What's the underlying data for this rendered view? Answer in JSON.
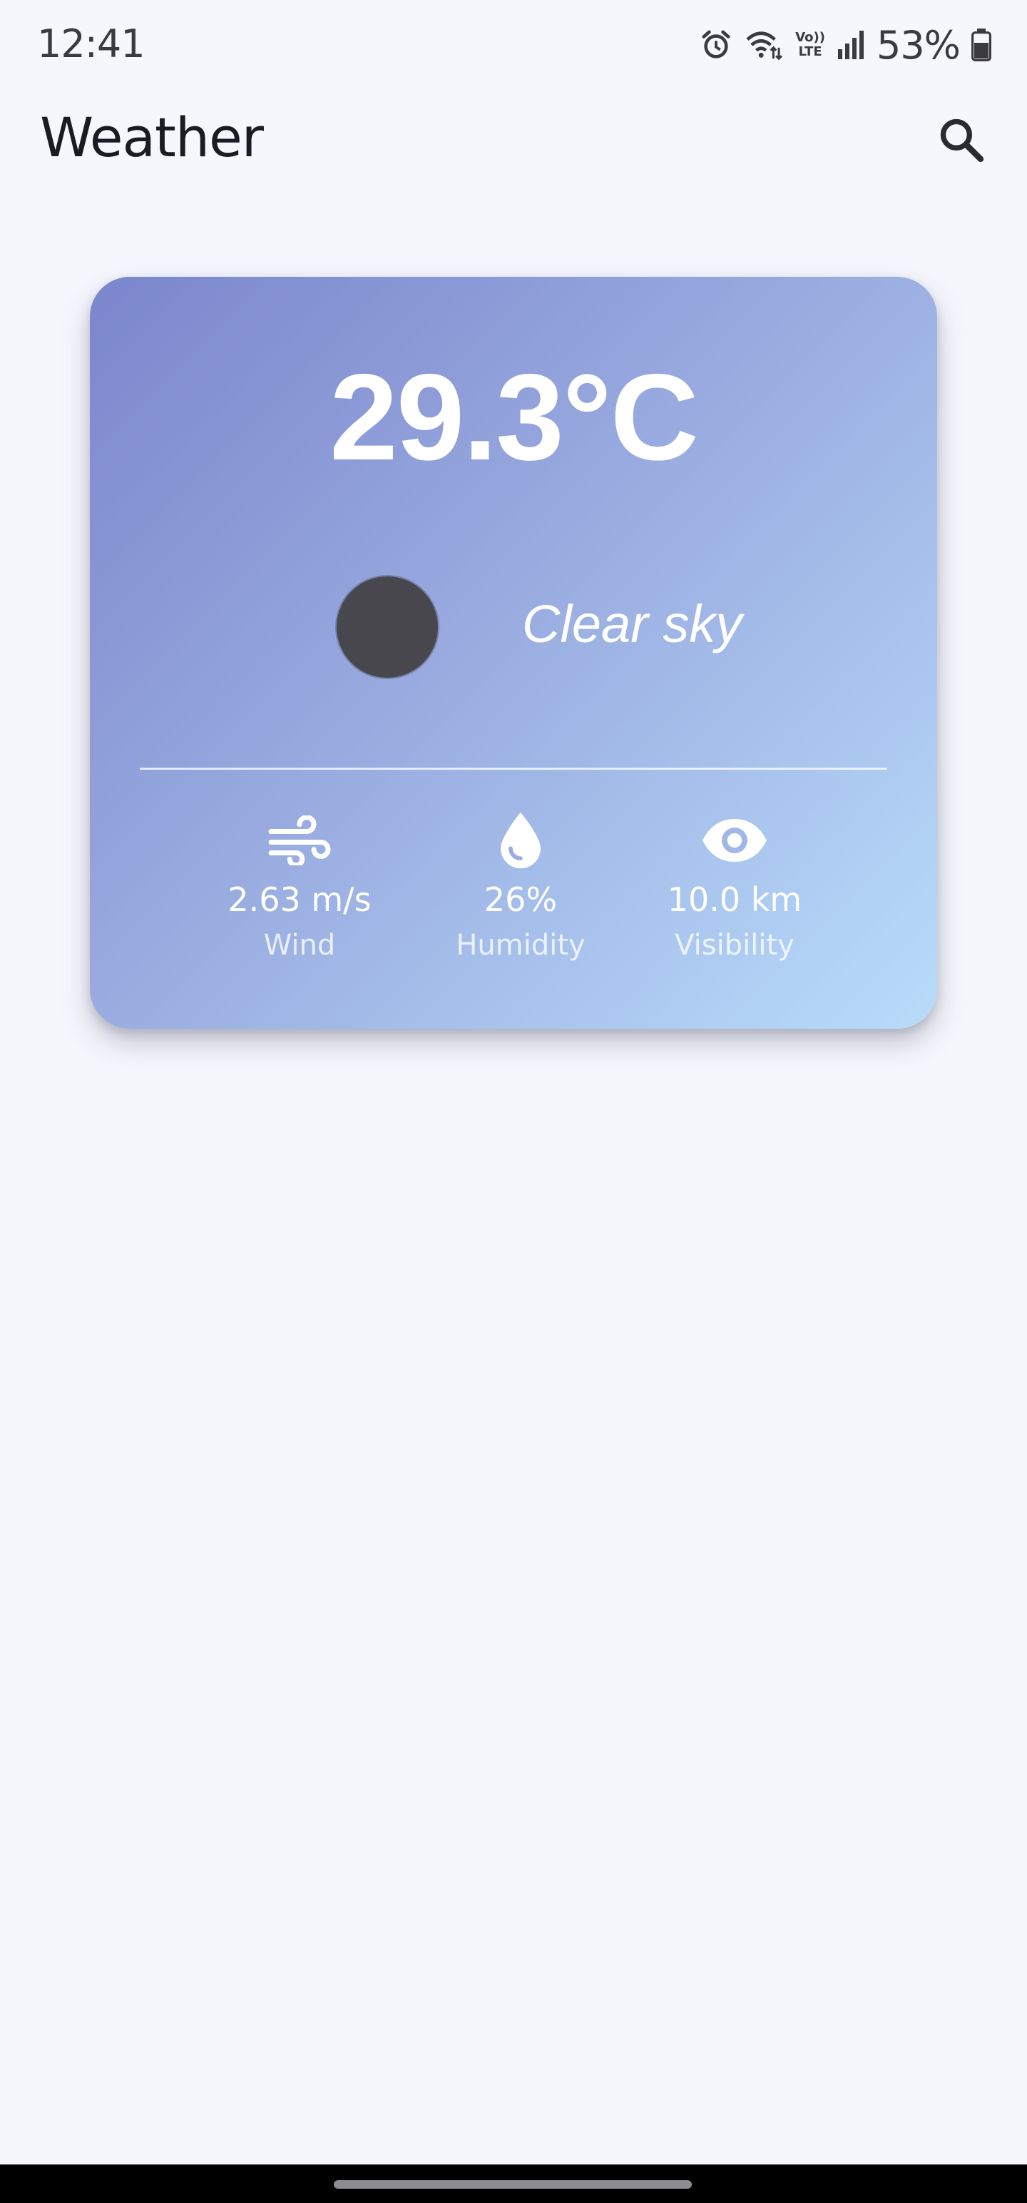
{
  "status_bar": {
    "time": "12:41",
    "battery_percent": "53%",
    "volte_top": "Vo))",
    "volte_bottom": "LTE",
    "icons": [
      "alarm-icon",
      "wifi-icon",
      "volte-icon",
      "signal-icon",
      "battery-icon"
    ]
  },
  "app_bar": {
    "title": "Weather",
    "search_icon": "search-icon"
  },
  "weather": {
    "temperature": "29.3°C",
    "condition": "Clear sky",
    "condition_icon": "dark-circle",
    "stats": [
      {
        "icon": "wind-icon",
        "value": "2.63 m/s",
        "label": "Wind"
      },
      {
        "icon": "water-drop-icon",
        "value": "26%",
        "label": "Humidity"
      },
      {
        "icon": "eye-icon",
        "value": "10.0 km",
        "label": "Visibility"
      }
    ]
  },
  "colors": {
    "background": "#f6f7fd",
    "card_gradient_start": "#7b86cc",
    "card_gradient_end": "#b8dcfa",
    "text_primary": "#1b1b22",
    "card_text": "#ffffff"
  }
}
